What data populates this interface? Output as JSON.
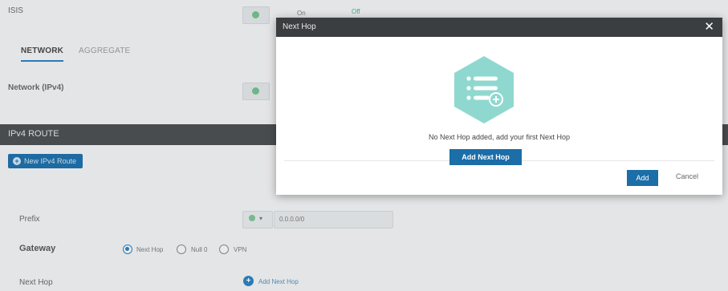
{
  "background": {
    "isis_label": "ISIS",
    "isis_on": "On",
    "isis_off": "Off",
    "tabs": [
      "NETWORK",
      "AGGREGATE"
    ],
    "network_label": "Network (IPv4)",
    "section_title": "IPv4 ROUTE",
    "new_route_button": "New IPv4 Route",
    "prefix_label": "Prefix",
    "prefix_value": "0.0.0.0/0",
    "gateway_label": "Gateway",
    "gateway_options": [
      "Next Hop",
      "Null 0",
      "VPN"
    ],
    "nexthop_label": "Next Hop",
    "add_next_hop_link": "Add Next Hop"
  },
  "modal": {
    "title": "Next Hop",
    "close_icon": "close-icon",
    "empty_message": "No Next Hop added, add your first Next Hop",
    "add_next_hop_button": "Add Next Hop",
    "add_button": "Add",
    "cancel_button": "Cancel",
    "illustration_icon": "list-add-icon"
  },
  "colors": {
    "accent": "#1b6ea8",
    "header": "#3b3e41",
    "illustration": "#8fd8cf"
  }
}
